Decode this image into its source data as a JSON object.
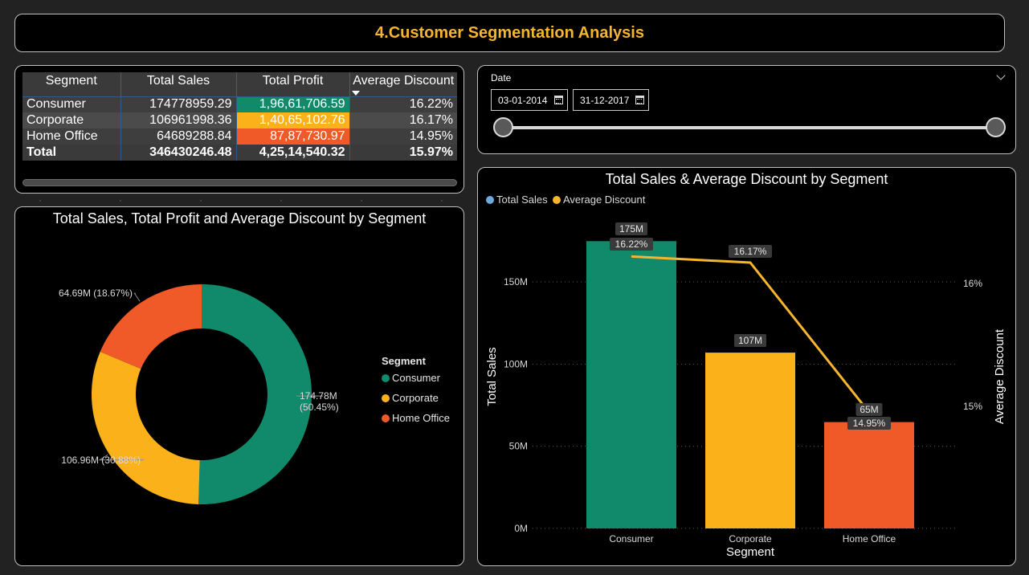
{
  "page": {
    "title": "4.Customer Segmentation Analysis"
  },
  "table": {
    "headers": [
      "Segment",
      "Total Sales",
      "Total Profit",
      "Average Discount"
    ],
    "rows": [
      {
        "segment": "Consumer",
        "sales": "174778959.29",
        "profit": "1,96,61,706.59",
        "discount": "16.22%",
        "profit_bg": "#118a6c",
        "profit_color": "#ffffff"
      },
      {
        "segment": "Corporate",
        "sales": "106961998.36",
        "profit": "1,40,65,102.76",
        "discount": "16.17%",
        "profit_bg": "#fbb21a",
        "profit_color": "#ffffff"
      },
      {
        "segment": "Home Office",
        "sales": "64689288.84",
        "profit": "87,87,730.97",
        "discount": "14.95%",
        "profit_bg": "#f05a28",
        "profit_color": "#ffffff"
      }
    ],
    "total": {
      "segment": "Total",
      "sales": "346430246.48",
      "profit": "4,25,14,540.32",
      "discount": "15.97%"
    }
  },
  "date_slicer": {
    "label": "Date",
    "start": "03-01-2014",
    "end": "31-12-2017",
    "range_fraction": [
      0,
      1
    ]
  },
  "colors": {
    "consumer": "#118a6c",
    "corporate": "#fbb21a",
    "home_office": "#f05a28",
    "title_accent": "#f5b52c",
    "sales_legend": "#6fa8dc",
    "line": "#f5b52c"
  },
  "chart_data": [
    {
      "type": "pie",
      "title": "Total Sales, Total Profit and Average Discount by Segment",
      "donut": true,
      "legend_title": "Segment",
      "legend_position": "right",
      "categories": [
        "Consumer",
        "Corporate",
        "Home Office"
      ],
      "values": [
        174.78,
        106.96,
        64.69
      ],
      "unit": "M",
      "data_labels": [
        "174.78M\n(50.45%)",
        "106.96M (30.88%)",
        "64.69M (18.67%)"
      ],
      "colors": [
        "#118a6c",
        "#fbb21a",
        "#f05a28"
      ]
    },
    {
      "type": "bar",
      "title": "Total Sales & Average Discount by Segment",
      "legend_position": "top-left",
      "categories": [
        "Consumer",
        "Corporate",
        "Home Office"
      ],
      "xlabel": "Segment",
      "ylabel": "Total Sales",
      "y2label": "Average Discount",
      "ylim": [
        0,
        200
      ],
      "y_ticks": [
        "0M",
        "50M",
        "100M",
        "150M"
      ],
      "y2_ticks": [
        "15%",
        "16%"
      ],
      "y2lim": [
        14.5,
        16.6
      ],
      "grid": true,
      "series": [
        {
          "name": "Total Sales",
          "kind": "bar",
          "values": [
            174.78,
            106.96,
            64.69
          ],
          "labels": [
            "175M",
            "107M",
            "65M"
          ],
          "colors": [
            "#118a6c",
            "#fbb21a",
            "#f05a28"
          ]
        },
        {
          "name": "Average Discount",
          "kind": "line",
          "axis": "secondary",
          "values": [
            16.22,
            16.17,
            14.95
          ],
          "labels": [
            "16.22%",
            "16.17%",
            "14.95%"
          ],
          "color": "#f5b52c"
        }
      ]
    }
  ]
}
